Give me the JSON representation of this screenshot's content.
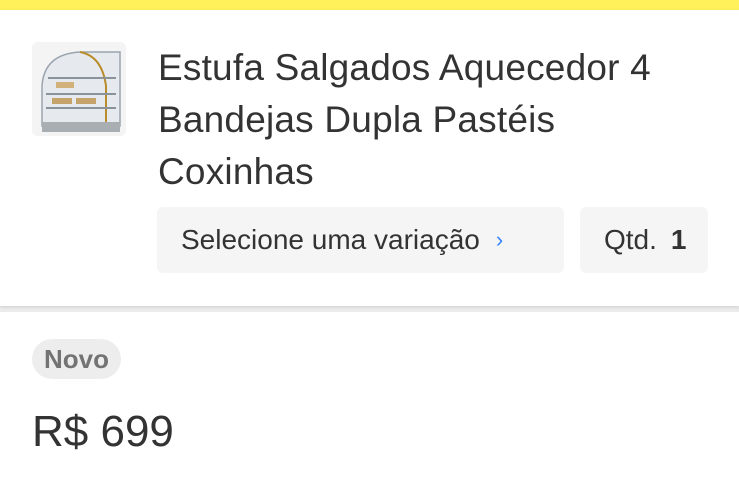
{
  "product": {
    "title": "Estufa Salgados Aquecedor 4 Bandejas Dupla Pastéis Coxinhas",
    "variation_label": "Selecione uma variação",
    "quantity_label": "Qtd.",
    "quantity_value": "1",
    "condition_badge": "Novo",
    "price": "R$ 699"
  },
  "icons": {
    "variation_chevron": "chevron-right-icon"
  },
  "colors": {
    "top_bar": "#fff159",
    "accent": "#3483fa",
    "text": "#333333",
    "badge_bg": "#ededed"
  }
}
